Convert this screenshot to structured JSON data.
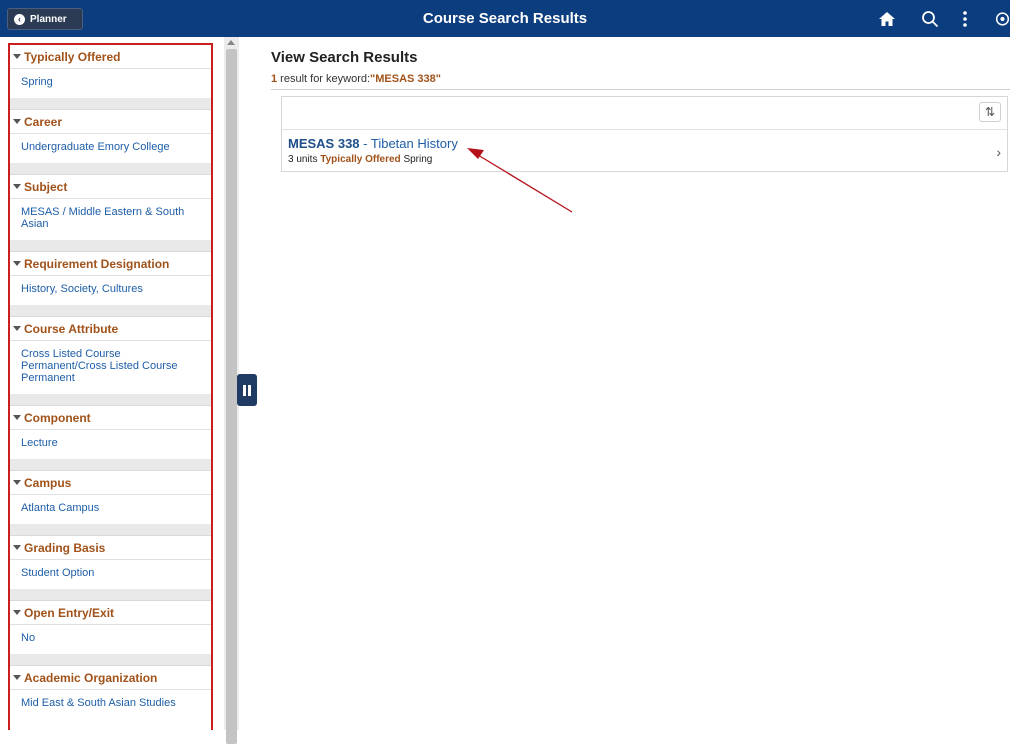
{
  "header": {
    "back_label": "Planner",
    "title": "Course Search Results",
    "icons": [
      "home-icon",
      "search-icon",
      "more-vertical-icon",
      "settings-icon"
    ]
  },
  "sidebar": {
    "facets": [
      {
        "title": "Typically Offered",
        "value": "Spring"
      },
      {
        "title": "Career",
        "value": "Undergraduate Emory College"
      },
      {
        "title": "Subject",
        "value": "MESAS / Middle Eastern & South Asian"
      },
      {
        "title": "Requirement Designation",
        "value": "History, Society, Cultures"
      },
      {
        "title": "Course Attribute",
        "value": "Cross Listed Course Permanent/Cross Listed Course Permanent"
      },
      {
        "title": "Component",
        "value": "Lecture"
      },
      {
        "title": "Campus",
        "value": "Atlanta Campus"
      },
      {
        "title": "Grading Basis",
        "value": "Student Option"
      },
      {
        "title": "Open Entry/Exit",
        "value": "No"
      },
      {
        "title": "Academic Organization",
        "value": "Mid East & South Asian Studies"
      }
    ]
  },
  "main": {
    "title": "View Search Results",
    "result_count": "1",
    "result_text": " result for keyword:",
    "keyword": "\"MESAS 338\"",
    "results": [
      {
        "code": "MESAS 338",
        "separator": " - ",
        "name": "Tibetan History",
        "units": "3 units",
        "offered_label": "Typically Offered",
        "offered_value": "Spring"
      }
    ]
  },
  "colors": {
    "header": "#0c3d7e",
    "facet_title": "#a0521a",
    "link": "#1e5ea8",
    "highlight_border": "#cc1e1e",
    "annotation_arrow": "#b5121b"
  }
}
